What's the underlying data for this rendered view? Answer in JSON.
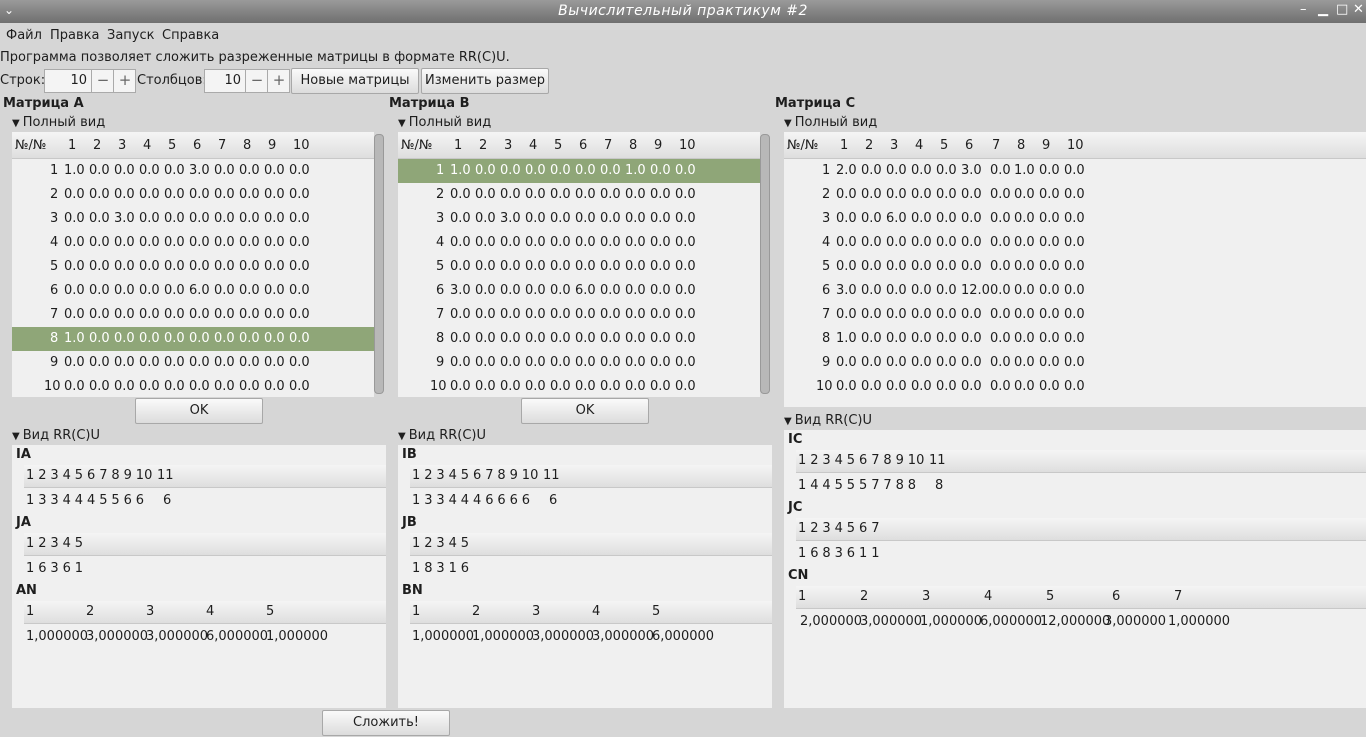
{
  "window": {
    "title": "Вычислительный практикум #2",
    "menu_icon": "⌄",
    "min": "–",
    "restore": "▁",
    "max": "□",
    "close": "✕"
  },
  "menu": [
    "Файл",
    "Правка",
    "Запуск",
    "Справка"
  ],
  "description": "Программа позволяет сложить разреженные матрицы в формате RR(C)U.",
  "controls": {
    "rows_label": "Строк:",
    "rows_value": "10",
    "cols_label": "Столбцов:",
    "cols_value": "10",
    "new_matrices": "Новые матрицы",
    "resize": "Изменить размер"
  },
  "full_view_label": "Полный вид",
  "rr_view_label": "Вид RR(C)U",
  "ok_label": "OK",
  "add_label": "Сложить!",
  "col_header_num": "№/№",
  "col_numbers": [
    "1",
    "2",
    "3",
    "4",
    "5",
    "6",
    "7",
    "8",
    "9",
    "10"
  ],
  "matrices": [
    {
      "title": "Матрица A",
      "selected_row": 7,
      "rows": [
        [
          "1.0",
          "0.0",
          "0.0",
          "0.0",
          "0.0",
          "3.0",
          "0.0",
          "0.0",
          "0.0",
          "0.0"
        ],
        [
          "0.0",
          "0.0",
          "0.0",
          "0.0",
          "0.0",
          "0.0",
          "0.0",
          "0.0",
          "0.0",
          "0.0"
        ],
        [
          "0.0",
          "0.0",
          "3.0",
          "0.0",
          "0.0",
          "0.0",
          "0.0",
          "0.0",
          "0.0",
          "0.0"
        ],
        [
          "0.0",
          "0.0",
          "0.0",
          "0.0",
          "0.0",
          "0.0",
          "0.0",
          "0.0",
          "0.0",
          "0.0"
        ],
        [
          "0.0",
          "0.0",
          "0.0",
          "0.0",
          "0.0",
          "0.0",
          "0.0",
          "0.0",
          "0.0",
          "0.0"
        ],
        [
          "0.0",
          "0.0",
          "0.0",
          "0.0",
          "0.0",
          "6.0",
          "0.0",
          "0.0",
          "0.0",
          "0.0"
        ],
        [
          "0.0",
          "0.0",
          "0.0",
          "0.0",
          "0.0",
          "0.0",
          "0.0",
          "0.0",
          "0.0",
          "0.0"
        ],
        [
          "1.0",
          "0.0",
          "0.0",
          "0.0",
          "0.0",
          "0.0",
          "0.0",
          "0.0",
          "0.0",
          "0.0"
        ],
        [
          "0.0",
          "0.0",
          "0.0",
          "0.0",
          "0.0",
          "0.0",
          "0.0",
          "0.0",
          "0.0",
          "0.0"
        ],
        [
          "0.0",
          "0.0",
          "0.0",
          "0.0",
          "0.0",
          "0.0",
          "0.0",
          "0.0",
          "0.0",
          "0.0"
        ]
      ],
      "rr": [
        {
          "label": "IA",
          "header": [
            "1",
            "2",
            "3",
            "4",
            "5",
            "6",
            "7",
            "8",
            "9",
            "10",
            "11"
          ],
          "values": [
            "1",
            "3",
            "3",
            "4",
            "4",
            "4",
            "5",
            "5",
            "6",
            "6",
            "6"
          ]
        },
        {
          "label": "JA",
          "header": [
            "1",
            "2",
            "3",
            "4",
            "5"
          ],
          "values": [
            "1",
            "6",
            "3",
            "6",
            "1"
          ]
        },
        {
          "label": "AN",
          "header": [
            "1",
            "2",
            "3",
            "4",
            "5"
          ],
          "values": [
            "1,000000",
            "3,000000",
            "3,000000",
            "6,000000",
            "1,000000"
          ]
        }
      ]
    },
    {
      "title": "Матрица B",
      "selected_row": 0,
      "rows": [
        [
          "1.0",
          "0.0",
          "0.0",
          "0.0",
          "0.0",
          "0.0",
          "0.0",
          "1.0",
          "0.0",
          "0.0"
        ],
        [
          "0.0",
          "0.0",
          "0.0",
          "0.0",
          "0.0",
          "0.0",
          "0.0",
          "0.0",
          "0.0",
          "0.0"
        ],
        [
          "0.0",
          "0.0",
          "3.0",
          "0.0",
          "0.0",
          "0.0",
          "0.0",
          "0.0",
          "0.0",
          "0.0"
        ],
        [
          "0.0",
          "0.0",
          "0.0",
          "0.0",
          "0.0",
          "0.0",
          "0.0",
          "0.0",
          "0.0",
          "0.0"
        ],
        [
          "0.0",
          "0.0",
          "0.0",
          "0.0",
          "0.0",
          "0.0",
          "0.0",
          "0.0",
          "0.0",
          "0.0"
        ],
        [
          "3.0",
          "0.0",
          "0.0",
          "0.0",
          "0.0",
          "6.0",
          "0.0",
          "0.0",
          "0.0",
          "0.0"
        ],
        [
          "0.0",
          "0.0",
          "0.0",
          "0.0",
          "0.0",
          "0.0",
          "0.0",
          "0.0",
          "0.0",
          "0.0"
        ],
        [
          "0.0",
          "0.0",
          "0.0",
          "0.0",
          "0.0",
          "0.0",
          "0.0",
          "0.0",
          "0.0",
          "0.0"
        ],
        [
          "0.0",
          "0.0",
          "0.0",
          "0.0",
          "0.0",
          "0.0",
          "0.0",
          "0.0",
          "0.0",
          "0.0"
        ],
        [
          "0.0",
          "0.0",
          "0.0",
          "0.0",
          "0.0",
          "0.0",
          "0.0",
          "0.0",
          "0.0",
          "0.0"
        ]
      ],
      "rr": [
        {
          "label": "IB",
          "header": [
            "1",
            "2",
            "3",
            "4",
            "5",
            "6",
            "7",
            "8",
            "9",
            "10",
            "11"
          ],
          "values": [
            "1",
            "3",
            "3",
            "4",
            "4",
            "4",
            "6",
            "6",
            "6",
            "6",
            "6"
          ]
        },
        {
          "label": "JB",
          "header": [
            "1",
            "2",
            "3",
            "4",
            "5"
          ],
          "values": [
            "1",
            "8",
            "3",
            "1",
            "6"
          ]
        },
        {
          "label": "BN",
          "header": [
            "1",
            "2",
            "3",
            "4",
            "5"
          ],
          "values": [
            "1,000000",
            "1,000000",
            "3,000000",
            "3,000000",
            "6,000000"
          ]
        }
      ]
    },
    {
      "title": "Матрица C",
      "selected_row": -1,
      "rows": [
        [
          "2.0",
          "0.0",
          "0.0",
          "0.0",
          "0.0",
          "3.0",
          "0.0",
          "1.0",
          "0.0",
          "0.0"
        ],
        [
          "0.0",
          "0.0",
          "0.0",
          "0.0",
          "0.0",
          "0.0",
          "0.0",
          "0.0",
          "0.0",
          "0.0"
        ],
        [
          "0.0",
          "0.0",
          "6.0",
          "0.0",
          "0.0",
          "0.0",
          "0.0",
          "0.0",
          "0.0",
          "0.0"
        ],
        [
          "0.0",
          "0.0",
          "0.0",
          "0.0",
          "0.0",
          "0.0",
          "0.0",
          "0.0",
          "0.0",
          "0.0"
        ],
        [
          "0.0",
          "0.0",
          "0.0",
          "0.0",
          "0.0",
          "0.0",
          "0.0",
          "0.0",
          "0.0",
          "0.0"
        ],
        [
          "3.0",
          "0.0",
          "0.0",
          "0.0",
          "0.0",
          "12.0",
          "0.0",
          "0.0",
          "0.0",
          "0.0"
        ],
        [
          "0.0",
          "0.0",
          "0.0",
          "0.0",
          "0.0",
          "0.0",
          "0.0",
          "0.0",
          "0.0",
          "0.0"
        ],
        [
          "1.0",
          "0.0",
          "0.0",
          "0.0",
          "0.0",
          "0.0",
          "0.0",
          "0.0",
          "0.0",
          "0.0"
        ],
        [
          "0.0",
          "0.0",
          "0.0",
          "0.0",
          "0.0",
          "0.0",
          "0.0",
          "0.0",
          "0.0",
          "0.0"
        ],
        [
          "0.0",
          "0.0",
          "0.0",
          "0.0",
          "0.0",
          "0.0",
          "0.0",
          "0.0",
          "0.0",
          "0.0"
        ]
      ],
      "rr": [
        {
          "label": "IC",
          "header": [
            "1",
            "2",
            "3",
            "4",
            "5",
            "6",
            "7",
            "8",
            "9",
            "10",
            "11"
          ],
          "values": [
            "1",
            "4",
            "4",
            "5",
            "5",
            "5",
            "7",
            "7",
            "8",
            "8",
            "8"
          ]
        },
        {
          "label": "JC",
          "header": [
            "1",
            "2",
            "3",
            "4",
            "5",
            "6",
            "7"
          ],
          "values": [
            "1",
            "6",
            "8",
            "3",
            "6",
            "1",
            "1"
          ]
        },
        {
          "label": "CN",
          "header": [
            "1",
            "2",
            "3",
            "4",
            "5",
            "6",
            "7"
          ],
          "values": [
            "2,000000",
            "3,000000",
            "1,000000",
            "6,000000",
            "12,000000",
            "3,000000",
            "1,000000"
          ]
        }
      ]
    }
  ]
}
